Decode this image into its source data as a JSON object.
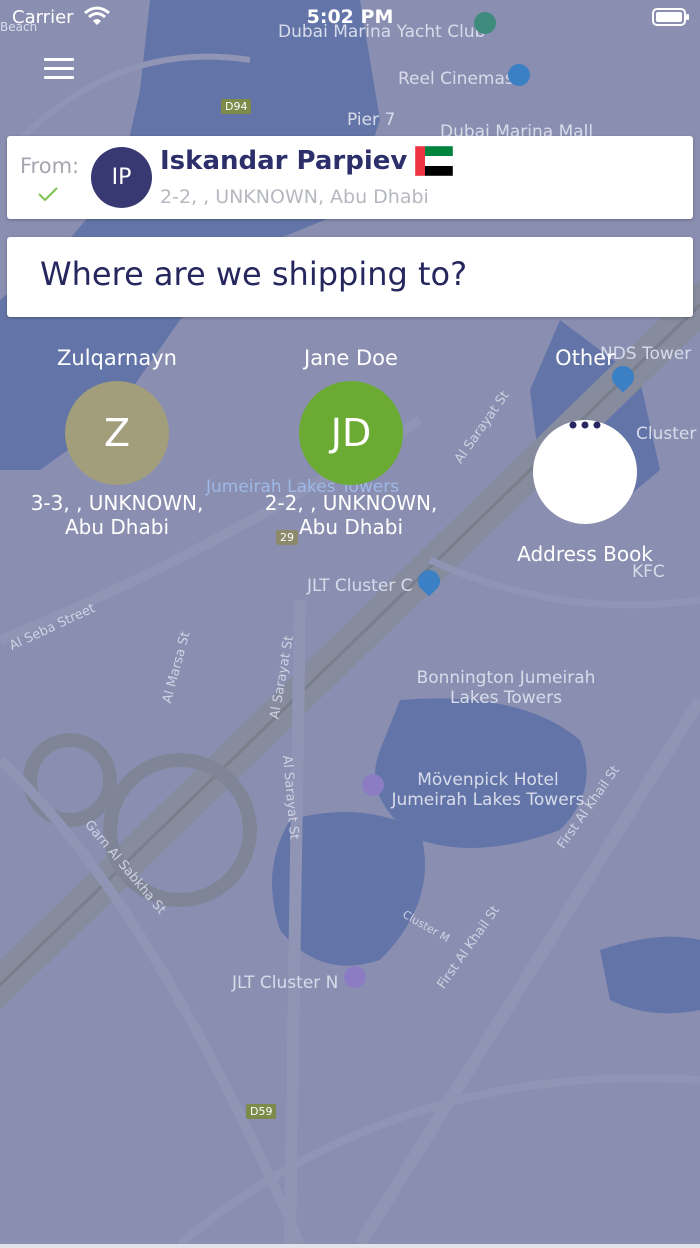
{
  "status_bar": {
    "carrier": "Carrier",
    "time": "5:02 PM"
  },
  "map": {
    "labels": [
      "Beach",
      "Dubai Marina Yacht Club",
      "Reel Cinemas",
      "Pier 7",
      "Dubai Marina Mall",
      "D94",
      "NDS Tower",
      "Cluster G",
      "Jumeirah Lakes Towers",
      "JLT Cluster C",
      "KFC",
      "Al Sarayat St",
      "Al Seba Street",
      "Al Marsa St",
      "Bonnington Jumeirah Lakes Towers",
      "Mövenpick Hotel Jumeirah Lakes Towers",
      "Garn Al Sabkha St",
      "Cluster M",
      "First Al Khail St",
      "JLT Cluster N",
      "D59",
      "29"
    ]
  },
  "from": {
    "label": "From:",
    "initials": "IP",
    "name": "Iskandar Parpiev",
    "address": "2-2, , UNKNOWN, Abu Dhabi",
    "avatar_color": "#383873"
  },
  "destination": {
    "prompt": "Where are we shipping to?"
  },
  "recipients": [
    {
      "name": "Zulqarnayn",
      "initials": "Z",
      "address_line1": "3-3, , UNKNOWN,",
      "address_line2": "Abu Dhabi",
      "color": "#a29e7c"
    },
    {
      "name": "Jane Doe",
      "initials": "JD",
      "address_line1": "2-2, , UNKNOWN,",
      "address_line2": "Abu Dhabi",
      "color": "#6bab34"
    },
    {
      "name": "Other",
      "initials": "",
      "address_line1": "Address Book",
      "address_line2": "",
      "color": "#ffffff"
    }
  ],
  "icons": {
    "menu": "hamburger-menu-icon",
    "check": "check-icon",
    "flag": "uae-flag-icon",
    "more": "more-dots-icon",
    "wifi": "wifi-icon",
    "battery": "battery-icon"
  }
}
